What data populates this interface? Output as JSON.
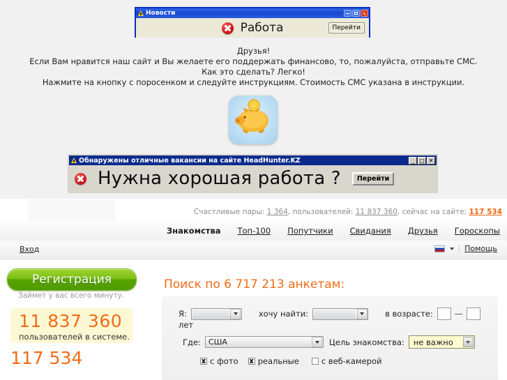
{
  "banner1": {
    "title": "Новости",
    "headline": "Работа",
    "button": "Перейти",
    "icons": {
      "warning": "warning-triangle-icon",
      "error": "error-x-icon"
    },
    "window_buttons": [
      "minimize",
      "maximize",
      "close"
    ]
  },
  "sms_promo": {
    "line1": "Друзья!",
    "line2": "Если Вам нравится наш сайт и Вы желаете его поддержать финансово, то, пожалуйста, отправьте СМС.",
    "line3": "Как это сделать? Легко!",
    "line4": "Нажмите на кнопку с поросенком и следуйте инструкциям. Стоимость СМС указана в инструкции.",
    "icon": "piggy-bank-icon"
  },
  "banner2": {
    "title": "Обнаружены отличные вакансии на сайте HeadHunter.KZ",
    "headline": "Нужна хорошая работа ?",
    "button": "Перейти",
    "window_buttons": [
      "_",
      "□",
      "✕"
    ]
  },
  "site": {
    "stats": {
      "couples_label": "Счастливые пары:",
      "couples_value": "1 364",
      "users_label": "пользователей:",
      "users_value": "11 837 360",
      "online_label": "сейчас на сайте:",
      "online_value": "117 534"
    },
    "nav": [
      {
        "label": "Знакомства",
        "active": true
      },
      {
        "label": "Топ-100",
        "active": false
      },
      {
        "label": "Попутчики",
        "active": false
      },
      {
        "label": "Свидания",
        "active": false
      },
      {
        "label": "Друзья",
        "active": false
      },
      {
        "label": "Гороскопы",
        "active": false
      }
    ],
    "login_bar": {
      "login_label": "Вход",
      "help_label": "Помощь",
      "language_flag": "russia-flag-icon"
    },
    "left": {
      "register_button": "Регистрация",
      "register_sub": "Займет у вас всего минуту.",
      "users_count": "11 837 360",
      "users_caption": "пользователей в системе.",
      "online_count": "117 534"
    },
    "search": {
      "title": "Поиск по 6 717 213 анкетам:",
      "i_am_label": "Я:",
      "i_am_value": "",
      "want_label": "хочу найти:",
      "want_value": "",
      "age_label": "в возрасте:",
      "age_from": "",
      "age_to": "",
      "age_unit": "лет",
      "where_label": "Где:",
      "where_value": "США",
      "goal_label": "Цель знакомства:",
      "goal_value": "не важно",
      "checkboxes": [
        {
          "label": "с фото",
          "checked": true
        },
        {
          "label": "реальные",
          "checked": true
        },
        {
          "label": "с веб-камерой",
          "checked": false
        }
      ]
    }
  },
  "colors": {
    "accent": "#f26a16",
    "green": "#58a400",
    "nav_blue": "#0a2b8c"
  }
}
